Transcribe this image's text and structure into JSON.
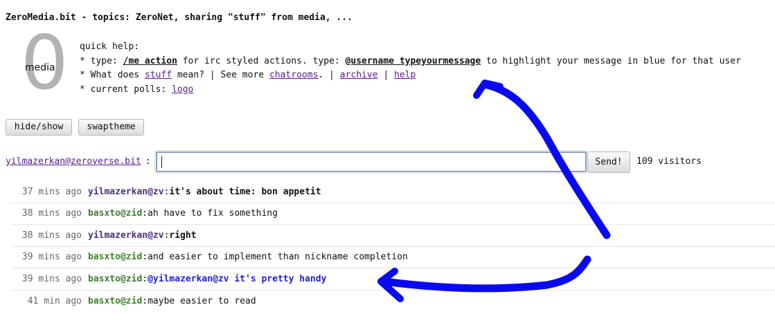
{
  "page_title": "ZeroMedia.bit - topics: ZeroNet, sharing \"stuff\" from media, ...",
  "logo": {
    "digit": "0",
    "word": "media"
  },
  "help": {
    "line1": "quick help:",
    "line2_prefix": "* type: ",
    "line2_cmd": "/me action",
    "line2_mid": " for irc styled actions.   type: ",
    "line2_cmd2": "@username typeyourmessage",
    "line2_suffix": " to highlight your message in blue for that user",
    "line3_prefix": "* What does ",
    "line3_link_stuff": "stuff",
    "line3_mid": " mean?  |  See more ",
    "line3_link_chatrooms": "chatrooms",
    "line3_sep1": ".  |  ",
    "line3_link_archive": "archive",
    "line3_sep2": "  |  ",
    "line3_link_help": "help",
    "line4_prefix": "* current polls: ",
    "line4_link_logo": "logo"
  },
  "buttons": {
    "hide_show": "hide/show",
    "swaptheme": "swaptheme",
    "send": "Send!"
  },
  "user": {
    "name": "yilmazerkan@zeroverse.bit",
    "colon": ":"
  },
  "input": {
    "value": "",
    "placeholder": ""
  },
  "visitors": "109 visitors",
  "messages": [
    {
      "time": "37 mins ago",
      "user": "yilmazerkan@zv",
      "sep": ": ",
      "text": "it's about time: bon appetit"
    },
    {
      "time": "38 mins ago",
      "user": "basxto@zid",
      "sep": ": ",
      "text": "ah have to fix something"
    },
    {
      "time": "38 mins ago",
      "user": "yilmazerkan@zv",
      "sep": ": ",
      "text": "right"
    },
    {
      "time": "39 mins ago",
      "user": "basxto@zid",
      "sep": ": ",
      "text": "and easier to implement than nickname completion"
    },
    {
      "time": "39 mins ago",
      "user": "basxto@zid",
      "sep": ": ",
      "text": "@yilmazerkan@zv it's pretty handy"
    },
    {
      "time": "41 min ago",
      "user": "basxto@zid",
      "sep": ": ",
      "text": "maybe easier to read"
    }
  ],
  "colors": {
    "link": "#551a8b",
    "user_purple": "#4b2f7f",
    "user_green": "#3f7f2f",
    "mention_blue": "#1f1fd0",
    "annotation_blue": "#0a0af0"
  }
}
